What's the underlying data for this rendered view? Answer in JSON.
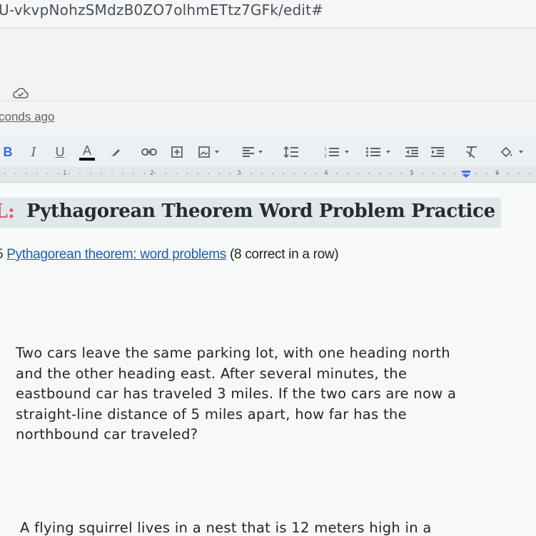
{
  "browser": {
    "url_fragment": "U-vkvpNohzSMdzB0ZO7olhmETtz7GFk/edit#"
  },
  "doc_header": {
    "save_status": "conds ago"
  },
  "toolbar": {
    "bold_label": "B",
    "italic_label": "I",
    "underline_label": "U",
    "text_color_label": "A",
    "text_color_swatch": "#000000"
  },
  "ruler": {
    "numbers": [
      "1",
      "2",
      "3",
      "4",
      "5",
      "6"
    ]
  },
  "document": {
    "title_prefix": "L:",
    "title": "Pythagorean Theorem Word Problem Practice",
    "skill": {
      "number": "5",
      "link_text": "Pythagorean theorem: word problems",
      "note": "(8 correct in a row)"
    },
    "question_1_lines": [
      "Two cars leave the same parking lot, with one heading north",
      "and the other heading east. After several minutes, the",
      "eastbound car has traveled 3 miles. If the two cars are now a",
      "straight-line distance of 5 miles apart, how far has the",
      "northbound car traveled?"
    ],
    "question_2_partial": "A flying squirrel lives in a nest that is 12 meters high in a"
  },
  "colors": {
    "title_accent": "#e0566a",
    "link": "#1a5fb4",
    "title_highlight": "#dfe9ec"
  }
}
